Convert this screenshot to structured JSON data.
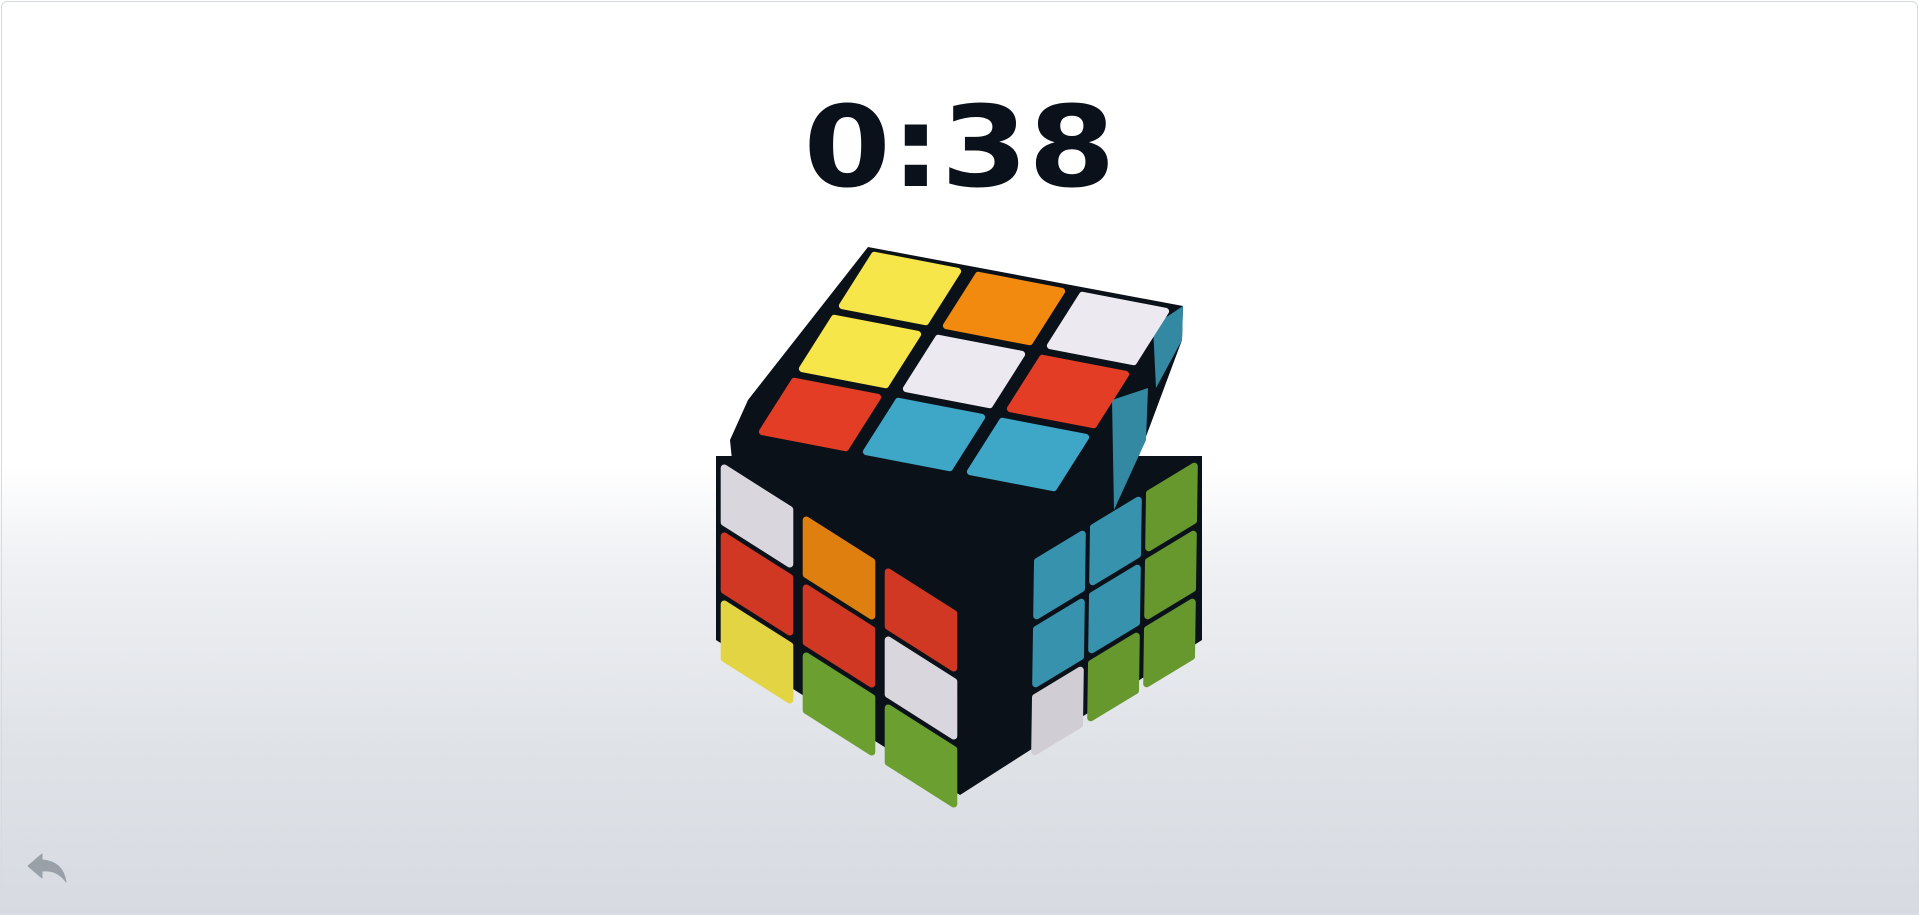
{
  "timer": {
    "text": "0:38"
  },
  "cube": {
    "top_face": {
      "rows": [
        [
          "yellow",
          "orange",
          "white"
        ],
        [
          "yellow",
          "white",
          "red"
        ],
        [
          "red",
          "blue",
          "blue"
        ]
      ]
    },
    "front_face": {
      "rows": [
        [
          "white",
          "orange",
          "red"
        ],
        [
          "red",
          "red",
          "white"
        ],
        [
          "yellow",
          "green",
          "green"
        ]
      ]
    },
    "side_face": {
      "rows": [
        [
          "blue",
          "blue",
          "green"
        ],
        [
          "blue",
          "blue",
          "green"
        ],
        [
          "white",
          "green",
          "green"
        ]
      ]
    },
    "colors": {
      "yellow": "#f7e64a",
      "orange": "#f28a10",
      "white": "#ede9f1",
      "red": "#e33d26",
      "blue": "#3ea6c6",
      "green": "#74ad34",
      "body": "#0b1118"
    }
  },
  "controls": {
    "back_icon": "undo-arrow-icon"
  }
}
